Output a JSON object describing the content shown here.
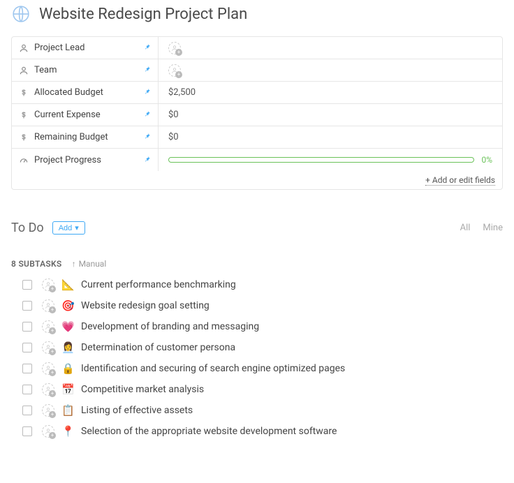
{
  "header": {
    "icon": "globe-icon",
    "title": "Website Redesign Project Plan"
  },
  "fields": [
    {
      "icon": "person",
      "label": "Project Lead",
      "value_type": "assignee",
      "value": ""
    },
    {
      "icon": "person",
      "label": "Team",
      "value_type": "assignee",
      "value": ""
    },
    {
      "icon": "dollar",
      "label": "Allocated Budget",
      "value_type": "text",
      "value": "$2,500"
    },
    {
      "icon": "dollar",
      "label": "Current Expense",
      "value_type": "text",
      "value": "$0"
    },
    {
      "icon": "dollar",
      "label": "Remaining Budget",
      "value_type": "text",
      "value": "$0"
    },
    {
      "icon": "gauge",
      "label": "Project Progress",
      "value_type": "progress",
      "value": "0%"
    }
  ],
  "fields_footer": {
    "add_edit": "+ Add or edit fields"
  },
  "section": {
    "title": "To Do",
    "add_label": "Add",
    "filters": {
      "all": "All",
      "mine": "Mine"
    }
  },
  "subtasks_header": {
    "count_label": "8 SUBTASKS",
    "sort_label": "Manual"
  },
  "tasks": [
    {
      "emoji": "📐",
      "title": "Current performance benchmarking"
    },
    {
      "emoji": "🎯",
      "title": "Website redesign goal setting"
    },
    {
      "emoji": "💗",
      "title": "Development of branding and messaging"
    },
    {
      "emoji": "👩‍💼",
      "title": "Determination of customer persona"
    },
    {
      "emoji": "🔒",
      "title": "Identification and securing of search engine optimized pages"
    },
    {
      "emoji": "📅",
      "title": "Competitive market analysis"
    },
    {
      "emoji": "📋",
      "title": "Listing of effective assets"
    },
    {
      "emoji": "📍",
      "title": "Selection of the appropriate website development software"
    }
  ],
  "colors": {
    "accent_blue": "#3ea9f5",
    "progress_green": "#6ac259"
  }
}
